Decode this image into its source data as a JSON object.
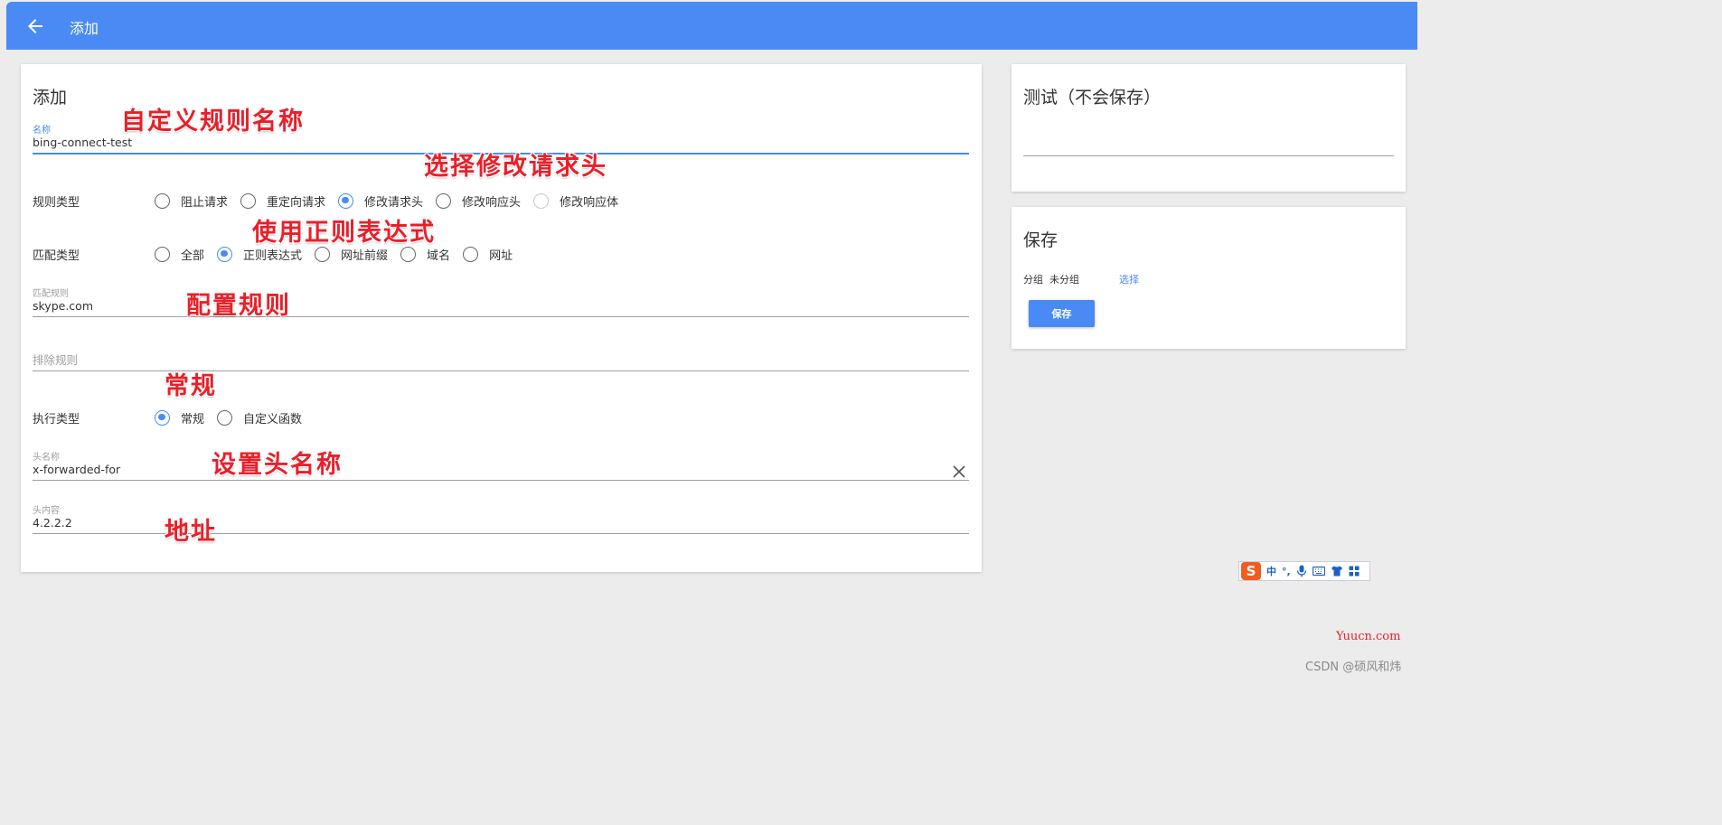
{
  "appbar": {
    "title": "添加",
    "back_icon": "arrow-left-icon"
  },
  "form": {
    "title": "添加",
    "name": {
      "label": "名称",
      "value": "bing-connect-test"
    },
    "rule_type": {
      "label": "规则类型",
      "options": [
        "阻止请求",
        "重定向请求",
        "修改请求头",
        "修改响应头",
        "修改响应体"
      ],
      "selected": "修改请求头"
    },
    "match_type": {
      "label": "匹配类型",
      "options": [
        "全部",
        "正则表达式",
        "网址前缀",
        "域名",
        "网址"
      ],
      "selected": "正则表达式"
    },
    "match_rule": {
      "label": "匹配规则",
      "value": "skype.com"
    },
    "exclude_rule": {
      "placeholder": "排除规则"
    },
    "exec_type": {
      "label": "执行类型",
      "options": [
        "常规",
        "自定义函数"
      ],
      "selected": "常规"
    },
    "header_name": {
      "label": "头名称",
      "value": "x-forwarded-for"
    },
    "header_value": {
      "label": "头内容",
      "value": "4.2.2.2"
    }
  },
  "test_card": {
    "title": "测试（不会保存）"
  },
  "save_card": {
    "title": "保存",
    "group_label": "分组",
    "group_value": "未分组",
    "select_link": "选择",
    "save_button": "保存"
  },
  "annotations": {
    "name": "自定义规则名称",
    "rule_type": "选择修改请求头",
    "match_type": "使用正则表达式",
    "match_rule": "配置规则",
    "exec_type": "常规",
    "header_name": "设置头名称",
    "header_value": "地址"
  },
  "ime_toolbar": {
    "logo": "S",
    "mode": "中",
    "punct": "°,",
    "icons": [
      "mic-icon",
      "keyboard-icon",
      "shirt-icon",
      "grid-icon"
    ]
  },
  "watermarks": {
    "site": "Yuucn.com",
    "author": "CSDN @硕风和炜"
  },
  "colors": {
    "primary": "#4a8af4",
    "annotation": "#e8202a",
    "background": "#ececec"
  }
}
